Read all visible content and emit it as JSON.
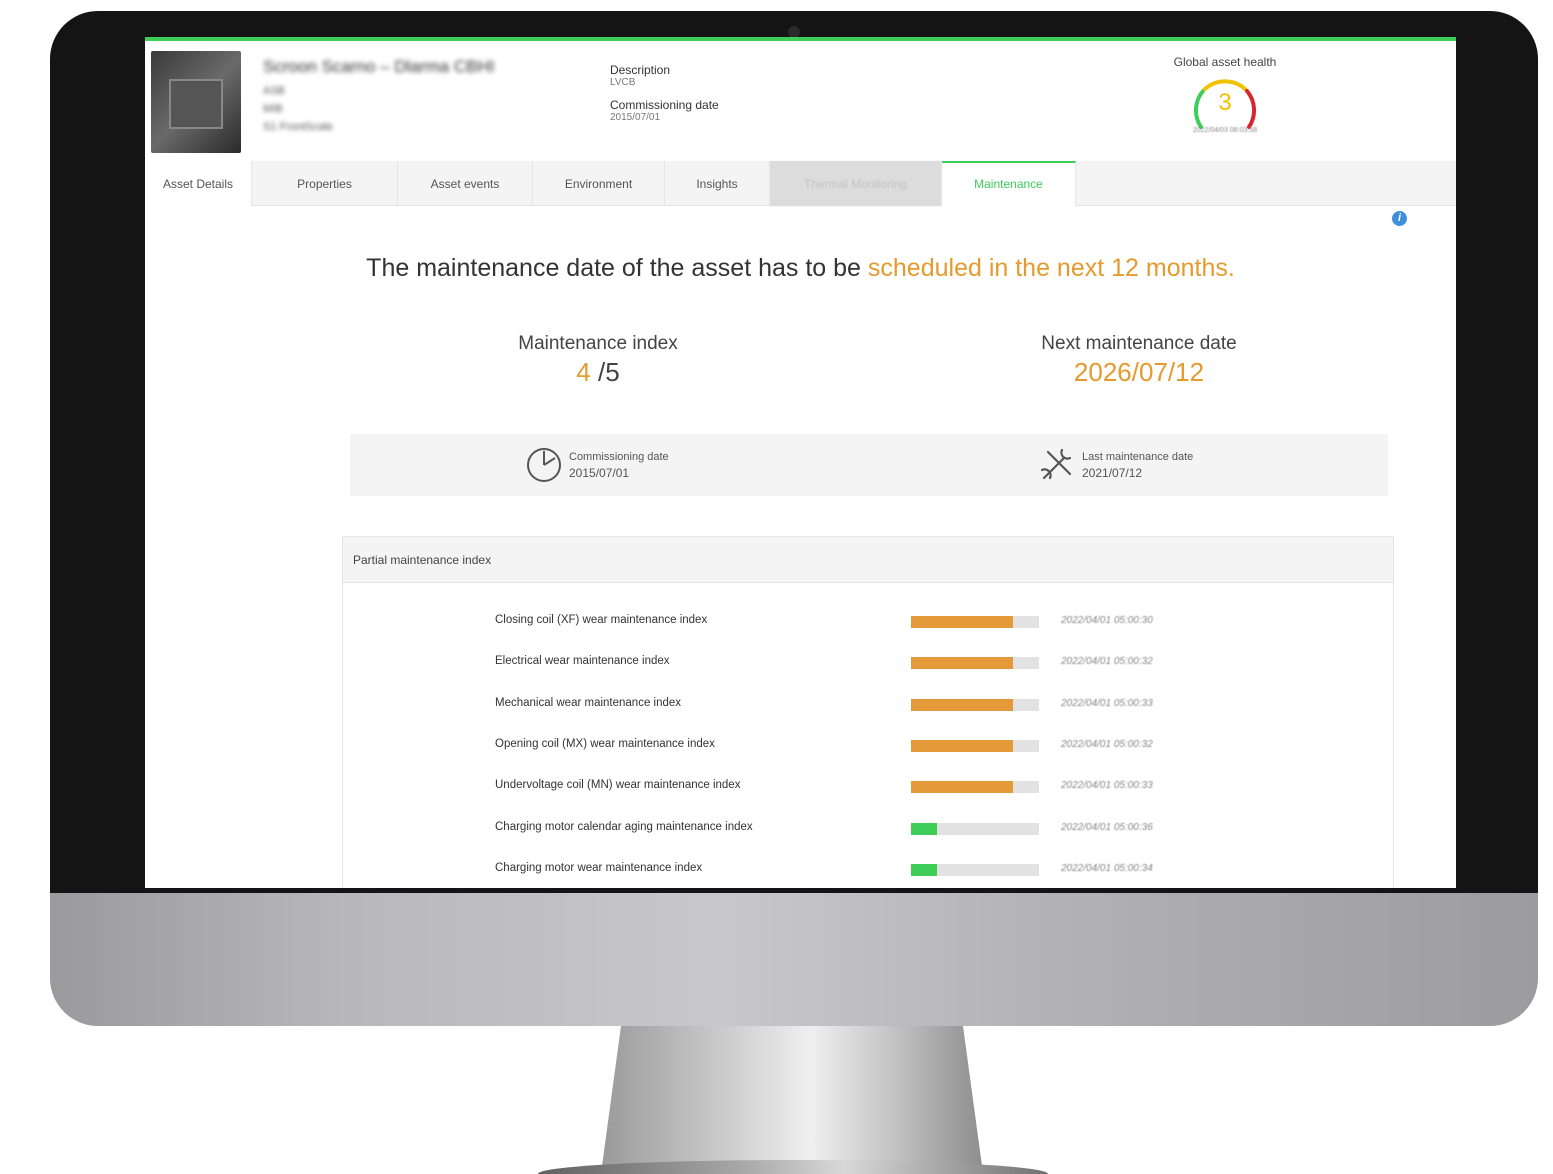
{
  "app": {
    "asset_title": "Scroon Scarno – Dlarma CBHI",
    "asset_meta": [
      "ASB",
      "MIB",
      "S1 FrontScale"
    ],
    "description_label": "Description",
    "description_value": "LVCB",
    "commissioning_label": "Commissioning date",
    "commissioning_value": "2015/07/01",
    "health_label": "Global asset health",
    "health_value": "3",
    "health_timestamp": "2022/04/03 08:03:58"
  },
  "tabs": [
    {
      "label": "Asset Details",
      "state": "default"
    },
    {
      "label": "Properties",
      "state": "default"
    },
    {
      "label": "Asset events",
      "state": "default"
    },
    {
      "label": "Environment",
      "state": "default"
    },
    {
      "label": "Insights",
      "state": "default"
    },
    {
      "label": "Thermal Monitoring",
      "state": "disabled"
    },
    {
      "label": "Maintenance",
      "state": "active"
    }
  ],
  "headline": {
    "prefix": "The maintenance date of the asset has to be ",
    "highlight": "scheduled in the next 12 months."
  },
  "maintenance_index": {
    "label": "Maintenance index",
    "value": "4",
    "denominator": " /5"
  },
  "next_maintenance": {
    "label": "Next maintenance date",
    "value": "2026/07/12"
  },
  "dates": {
    "commissioning_label": "Commissioning date",
    "commissioning_value": "2015/07/01",
    "last_label": "Last maintenance date",
    "last_value": "2021/07/12"
  },
  "partial": {
    "title": "Partial maintenance index",
    "rows": [
      {
        "label": "Closing coil (XF) wear maintenance index",
        "level": 0.8,
        "color": "#e59a3a",
        "time": "2022/04/01 05:00:30"
      },
      {
        "label": "Electrical wear maintenance index",
        "level": 0.8,
        "color": "#e59a3a",
        "time": "2022/04/01 05:00:32"
      },
      {
        "label": "Mechanical wear maintenance index",
        "level": 0.8,
        "color": "#e59a3a",
        "time": "2022/04/01 05:00:33"
      },
      {
        "label": "Opening coil (MX) wear maintenance index",
        "level": 0.8,
        "color": "#e59a3a",
        "time": "2022/04/01 05:00:32"
      },
      {
        "label": "Undervoltage coil (MN) wear maintenance index",
        "level": 0.8,
        "color": "#e59a3a",
        "time": "2022/04/01 05:00:33"
      },
      {
        "label": "Charging motor calendar aging maintenance index",
        "level": 0.2,
        "color": "#3dcd58",
        "time": "2022/04/01 05:00:36"
      },
      {
        "label": "Charging motor wear maintenance index",
        "level": 0.2,
        "color": "#3dcd58",
        "time": "2022/04/01 05:00:34"
      }
    ]
  },
  "colors": {
    "accent": "#3dcd58",
    "warning": "#e59a2d",
    "info": "#3f8fd8"
  }
}
